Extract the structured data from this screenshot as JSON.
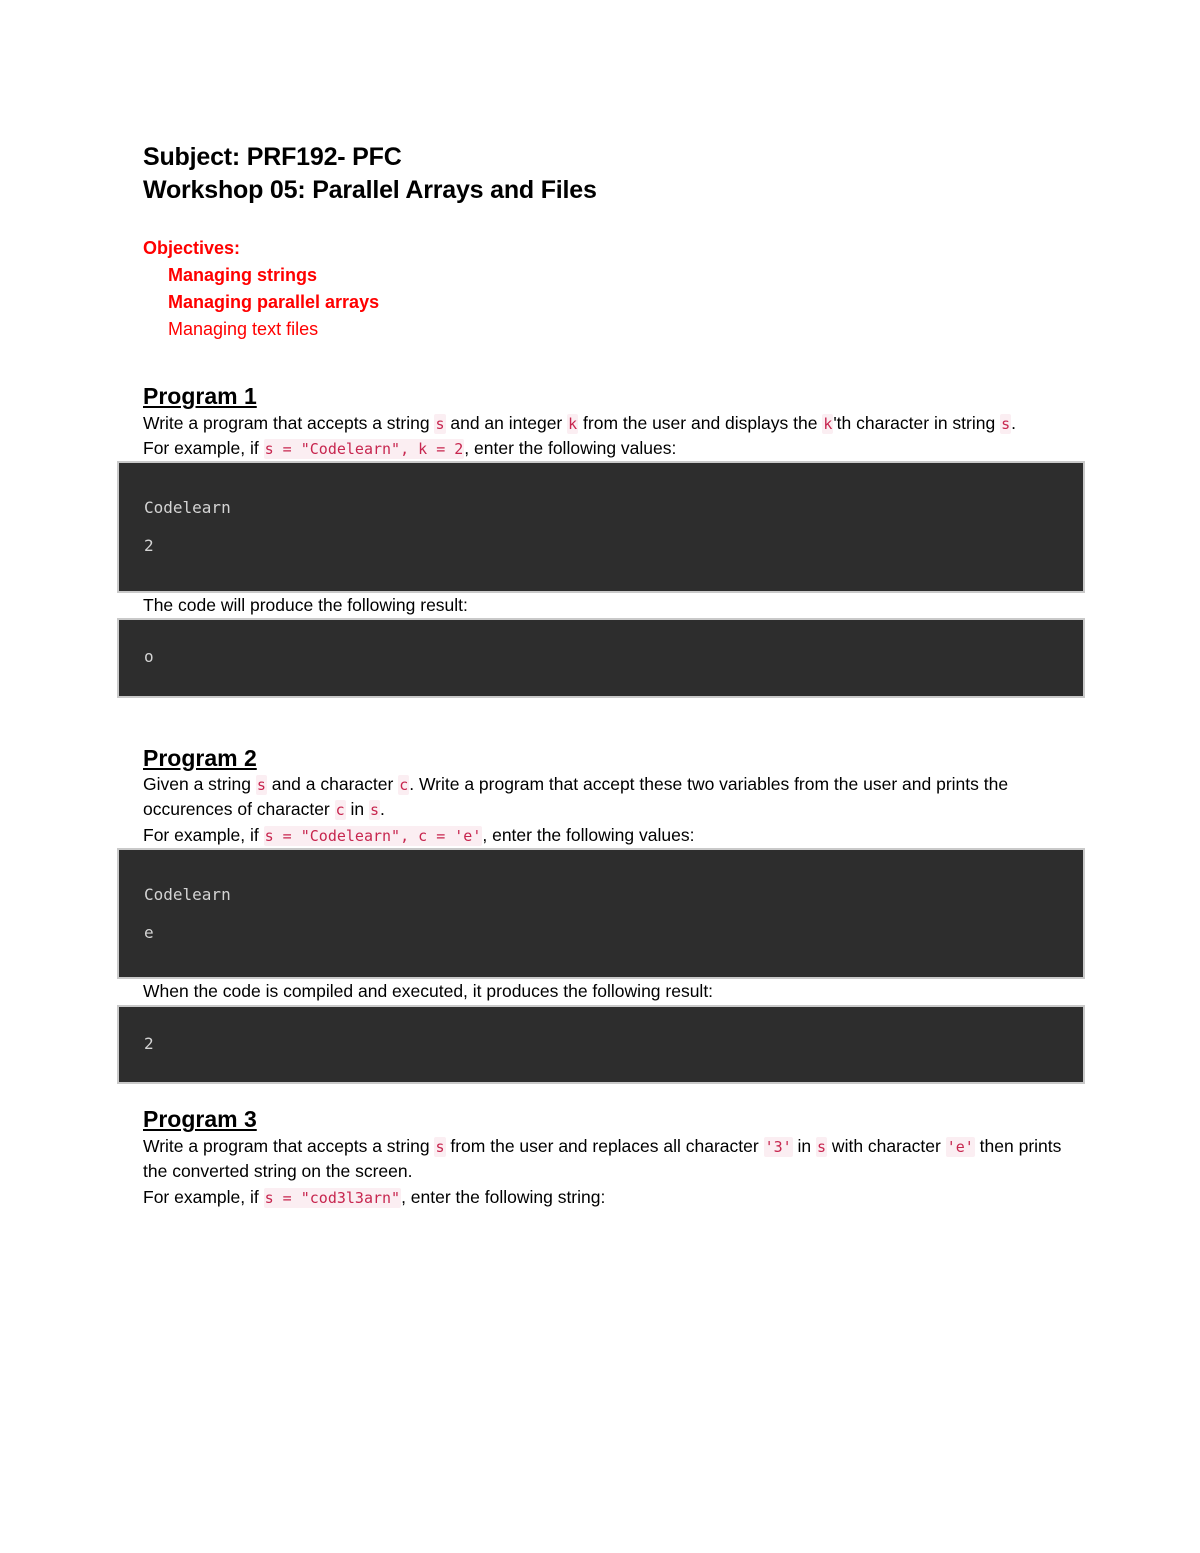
{
  "document": {
    "title_lines": [
      "Subject: PRF192- PFC",
      "Workshop 05: Parallel Arrays and Files"
    ],
    "objectives": {
      "heading": "Objectives:",
      "items": [
        "Managing strings",
        "Managing parallel arrays",
        "Managing text files"
      ]
    },
    "colors": {
      "objectives_red": "#ff0000",
      "inline_code_text": "#c7254e",
      "inline_code_bg": "#fbeef2",
      "code_block_bg": "#2d2d2d",
      "code_block_text": "#d4d4d4",
      "code_block_border": "#c9c9c9"
    },
    "programs": [
      {
        "heading": "Program 1",
        "desc_1_a": "Write a program that accepts a string ",
        "desc_1_code_s": "s",
        "desc_1_b": " and an integer ",
        "desc_1_code_k": "k",
        "desc_1_c": " from the user and displays the ",
        "desc_1_code_k2": "k",
        "desc_1_d": "'th character in string ",
        "desc_1_code_s2": "s",
        "desc_1_e": ".",
        "example_a": "For example, if ",
        "example_code": "s = \"Codelearn\", k = 2",
        "example_b": ", enter the following values:",
        "input_block": "Codelearn\n2",
        "result_label": "The code will produce the following result:",
        "output_block": "o"
      },
      {
        "heading": "Program 2",
        "desc_a": "Given a string ",
        "desc_code_s": "s",
        "desc_b": " and a character ",
        "desc_code_c": "c",
        "desc_c": ". Write a program that accept these two variables from the user and prints the occurences of character ",
        "desc_code_c2": "c",
        "desc_d": " in ",
        "desc_code_s2": "s",
        "desc_e": ".",
        "example_a": "For example, if ",
        "example_code": "s = \"Codelearn\", c = 'e'",
        "example_b": ", enter the following values:",
        "input_block": "Codelearn\ne",
        "result_label": "When the code is compiled and executed, it produces the following result:",
        "output_block": "2"
      },
      {
        "heading": "Program 3",
        "desc_a": "Write a program that accepts a string ",
        "desc_code_s": "s",
        "desc_b": " from the user and replaces all character ",
        "desc_code_3": "'3'",
        "desc_c": " in ",
        "desc_code_s2": "s",
        "desc_d": " with character ",
        "desc_code_e": "'e'",
        "desc_e": " then prints the converted string on the screen.",
        "example_a": "For example, if ",
        "example_code": "s = \"cod3l3arn\"",
        "example_b": ", enter the following string:"
      }
    ]
  }
}
